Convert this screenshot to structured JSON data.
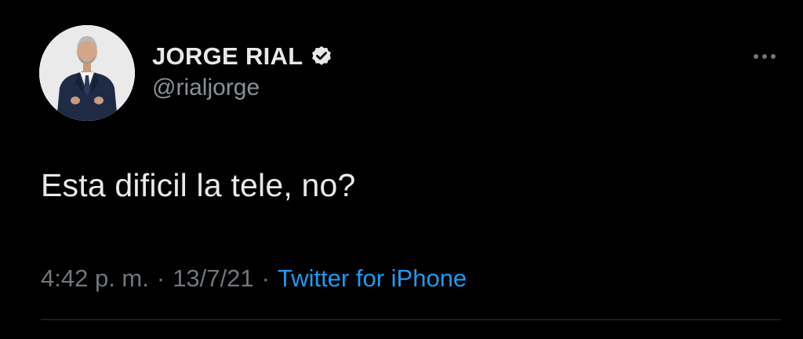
{
  "tweet": {
    "author": {
      "display_name": "JORGE RIAL",
      "handle": "@rialjorge",
      "verified": true,
      "avatar_icon": "person-in-suit-avatar"
    },
    "more_icon": "more-horizontal-icon",
    "text": "Esta dificil la tele, no?",
    "time": "4:42 p. m.",
    "date": "13/7/21",
    "separator": "·",
    "source": "Twitter for iPhone"
  },
  "colors": {
    "background": "#000000",
    "text_primary": "#e7e9ea",
    "text_secondary": "#71767b",
    "link": "#1d9bf0",
    "divider": "#2f3336"
  }
}
